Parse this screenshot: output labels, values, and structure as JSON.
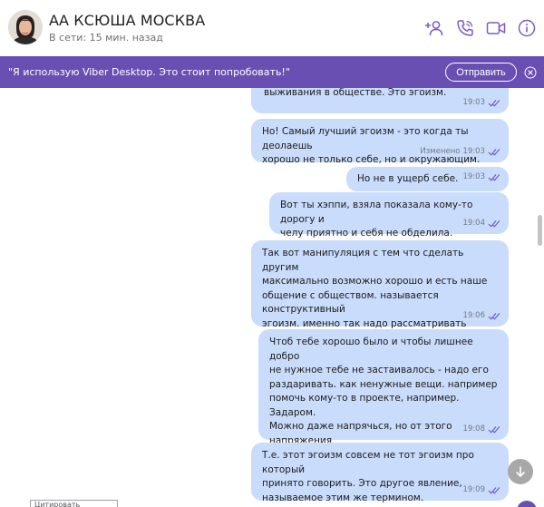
{
  "header": {
    "title": "АА КСЮША МОСКВА",
    "status": "В сети: 15 мин. назад",
    "icons": [
      "add-contact-icon",
      "call-icon",
      "video-icon",
      "info-icon"
    ],
    "accent_color": "#7b5cc4"
  },
  "banner": {
    "text": "\"Я использую Viber Desktop. Это стоит попробовать!\"",
    "button_label": "Отправить",
    "background": "#6a4fb3"
  },
  "messages": [
    {
      "text": "выживания в обществе. Это эгоизм.",
      "time": "19:03",
      "edited": ""
    },
    {
      "text": "Но! Самый лучший эгоизм - это когда ты деолаешь\nхорошо не только себе, но и окружающим.",
      "time": "19:03",
      "edited": "Изменено"
    },
    {
      "text": "Но не в ущерб себе.",
      "time": "19:03",
      "edited": ""
    },
    {
      "text": "Вот ты хэппи, взяла показала кому-то дорогу и\nчелу приятно и себя не обделила.",
      "time": "19:04",
      "edited": ""
    },
    {
      "text": "Так вот манипуляция с тем что сделать другим\nмаксимально возможно хорошо и есть наше\nобщение с обществом. называется конструктивный\nэгоизм. именно так надо рассматривать сисайти\nрелейшенз.",
      "time": "19:06",
      "edited": ""
    },
    {
      "text": "Чтоб тебе хорошо было и чтобы лишнее добро\nне нужное тебе не застаивалось - надо его\nраздаривать. как ненужные вещи. например\nпомочь кому-то в проекте, например. Задаром.\nМожно даже напрячься, но от этого напряжения\nты все равно получишь эндорфины - вот я какая\nблаготелельница.)",
      "time": "19:08",
      "edited": ""
    },
    {
      "text": "Т.е. этот эгоизм совсем не тот эгоизм про который\nпринято говорить. Это другое явление,\nназываемое этим же термином.",
      "time": "19:09",
      "edited": ""
    }
  ],
  "bubble_color": "#c9dcfb",
  "bottom": {
    "input_hint": "Цитировать"
  }
}
